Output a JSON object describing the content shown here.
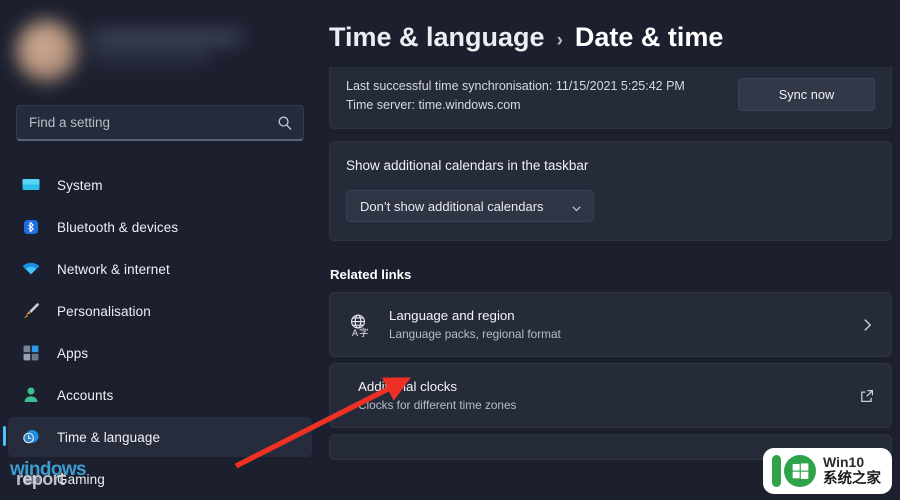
{
  "sidebar": {
    "search": {
      "placeholder": "Find a setting",
      "value": "",
      "icon": "search-icon"
    },
    "items": [
      {
        "label": "System",
        "icon": "display-icon"
      },
      {
        "label": "Bluetooth & devices",
        "icon": "bluetooth-icon"
      },
      {
        "label": "Network & internet",
        "icon": "wifi-icon"
      },
      {
        "label": "Personalisation",
        "icon": "paintbrush-icon"
      },
      {
        "label": "Apps",
        "icon": "apps-grid-icon"
      },
      {
        "label": "Accounts",
        "icon": "person-icon"
      },
      {
        "label": "Time & language",
        "icon": "clock-globe-icon",
        "selected": true
      },
      {
        "label": "Gaming",
        "icon": "gaming-icon"
      }
    ]
  },
  "header": {
    "breadcrumb_parent": "Time & language",
    "breadcrumb_separator": "›",
    "breadcrumb_current": "Date & time"
  },
  "main": {
    "sync_card": {
      "line1": "Last successful time synchronisation: 11/15/2021 5:25:42 PM",
      "line2": "Time server: time.windows.com",
      "button_label": "Sync now"
    },
    "calendars_card": {
      "title": "Show additional calendars in the taskbar",
      "dropdown_value": "Don’t show additional calendars",
      "dropdown_icon": "chevron-down-icon"
    },
    "related_links": {
      "heading": "Related links",
      "rows": [
        {
          "title": "Language and region",
          "subtitle": "Language packs, regional format",
          "icon": "language-globe-icon",
          "affordance": "chevron-right-icon"
        },
        {
          "title": "Additional clocks",
          "subtitle": "Clocks for different time zones",
          "icon": "",
          "affordance": "external-link-icon"
        }
      ]
    }
  },
  "watermarks": {
    "left_line1": "windows",
    "left_line2": "report",
    "right_line1": "Win10",
    "right_line2": "系统之家"
  },
  "colors": {
    "page_background": "#1b1f2e",
    "card_background": "#262b3a",
    "accent": "#4cc2ff",
    "annotation_arrow": "#ee3124",
    "watermark_green": "#2fa349"
  }
}
